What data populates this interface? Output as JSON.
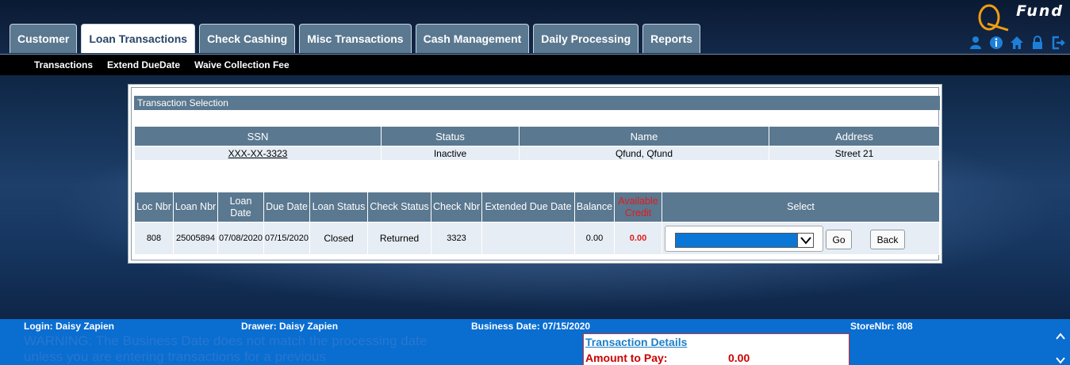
{
  "header": {
    "logo_text": "Fund",
    "tabs": [
      {
        "label": "Customer"
      },
      {
        "label": "Loan Transactions"
      },
      {
        "label": "Check Cashing"
      },
      {
        "label": "Misc Transactions"
      },
      {
        "label": "Cash Management"
      },
      {
        "label": "Daily Processing"
      },
      {
        "label": "Reports"
      }
    ],
    "active_tab": "Loan Transactions",
    "icons": [
      "user-icon",
      "info-icon",
      "home-icon",
      "lock-icon",
      "logout-icon"
    ],
    "icon_color": "#1e7fd8"
  },
  "subnav": {
    "items": [
      "Transactions",
      "Extend DueDate",
      "Waive Collection Fee"
    ]
  },
  "panel": {
    "title": "Transaction Selection",
    "customer_table": {
      "headers": [
        "SSN",
        "Status",
        "Name",
        "Address"
      ],
      "row": {
        "ssn": "XXX-XX-3323",
        "status": "Inactive",
        "name": "Qfund,  Qfund",
        "address": "Street 21"
      }
    },
    "loan_table": {
      "headers": [
        "Loc Nbr",
        "Loan Nbr",
        "Loan Date",
        "Due Date",
        "Loan Status",
        "Check Status",
        "Check Nbr",
        "Extended Due Date",
        "Balance",
        "Available Credit",
        "Select"
      ],
      "row": {
        "loc_nbr": "808",
        "loan_nbr": "25005894",
        "loan_date": "07/08/2020",
        "due_date": "07/15/2020",
        "loan_status": "Closed",
        "check_status": "Returned",
        "check_nbr": "3323",
        "extended_due_date": "",
        "balance": "0.00",
        "available_credit": "0.00"
      },
      "go_label": "Go",
      "back_label": "Back"
    }
  },
  "footer": {
    "login": "Login: Daisy Zapien",
    "drawer": "Drawer: Daisy Zapien",
    "business_date": "Business Date: 07/15/2020",
    "store": "StoreNbr: 808",
    "warning": "WARNING: The Business Date does not match the processing date unless you are entering transactions for a previous",
    "details_title": "Transaction Details",
    "amount_label": "Amount to Pay:",
    "amount_value": "0.00"
  },
  "colors": {
    "tab_bg": "#5a7890",
    "table_header": "#5a7890",
    "row_bg": "#e6edf4",
    "footer_bg": "#0a6dd0",
    "alert_red": "#e21b1b",
    "select_fill": "#0a76d6"
  }
}
